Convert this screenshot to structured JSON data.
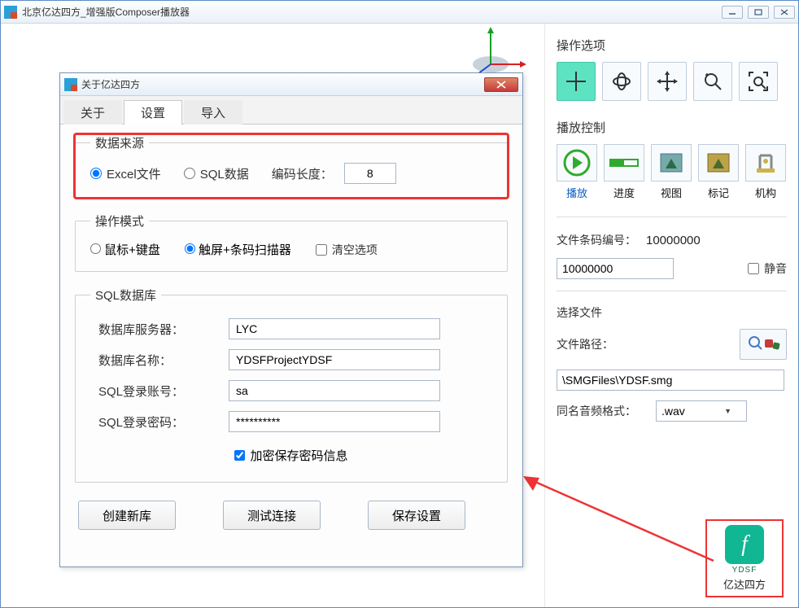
{
  "outer": {
    "title": "北京亿达四方_增强版Composer播放器"
  },
  "dialog": {
    "title": "关于亿达四方",
    "tabs": [
      "关于",
      "设置",
      "导入"
    ],
    "active_tab": "设置",
    "datasource": {
      "legend": "数据来源",
      "opt_excel": "Excel文件",
      "opt_sql": "SQL数据",
      "enc_label": "编码长度：",
      "enc_value": "8"
    },
    "opmode": {
      "legend": "操作模式",
      "opt_mouse": "鼠标+键盘",
      "opt_touch": "触屏+条码扫描器",
      "opt_clear": "清空选项"
    },
    "sqldb": {
      "legend": "SQL数据库",
      "server_label": "数据库服务器：",
      "server_value": "LYC",
      "dbname_label": "数据库名称：",
      "dbname_value": "YDSFProjectYDSF",
      "user_label": "SQL登录账号：",
      "user_value": "sa",
      "pass_label": "SQL登录密码：",
      "pass_value": "**********",
      "encrypt_label": "加密保存密码信息"
    },
    "buttons": {
      "create": "创建新库",
      "test": "测试连接",
      "save": "保存设置"
    }
  },
  "side": {
    "ops_title": "操作选项",
    "play_title": "播放控制",
    "play_labels": [
      "播放",
      "进度",
      "视图",
      "标记",
      "机构"
    ],
    "barcode_label": "文件条码编号：",
    "barcode_display": "10000000",
    "barcode_value": "10000000",
    "mute_label": "静音",
    "selectfile_title": "选择文件",
    "path_label": "文件路径：",
    "path_value": "\\SMGFiles\\YDSF.smg",
    "audiofmt_label": "同名音频格式：",
    "audiofmt_value": ".wav",
    "logo_en": "YDSF",
    "logo_cn": "亿达四方"
  }
}
